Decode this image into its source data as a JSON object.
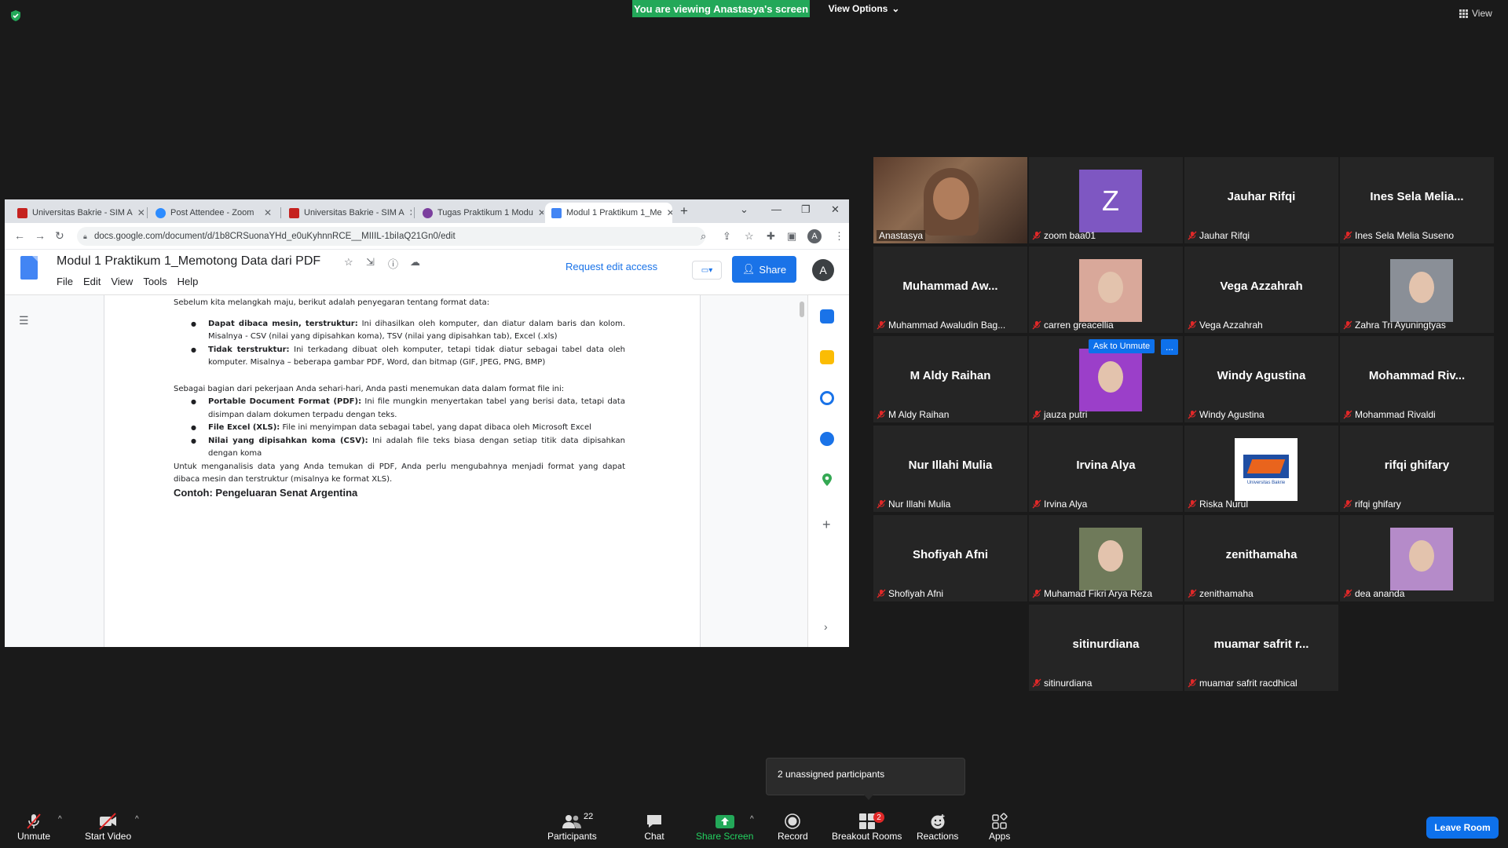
{
  "zoom": {
    "banner": "You are viewing Anastasya's screen",
    "view_options": "View Options",
    "view_label": "View"
  },
  "browser": {
    "tabs": [
      {
        "label": "Universitas Bakrie - SIM A",
        "fav_color": "#c5221f"
      },
      {
        "label": "Post Attendee - Zoom",
        "fav_color": "#2d8cff"
      },
      {
        "label": "Universitas Bakrie - SIM A",
        "fav_color": "#c5221f"
      },
      {
        "label": "Tugas Praktikum 1 Modu",
        "fav_color": "#7b3f9e"
      },
      {
        "label": "Modul 1 Praktikum 1_Me",
        "fav_color": "#4285f4",
        "active": true
      }
    ],
    "url": "docs.google.com/document/d/1b8CRSuonaYHd_e0uKyhnnRCE__MIIIL-1biIaQ21Gn0/edit",
    "profile_initial": "A"
  },
  "docs": {
    "title": "Modul 1 Praktikum 1_Memotong Data dari PDF",
    "menus": [
      "File",
      "Edit",
      "View",
      "Tools",
      "Help"
    ],
    "request_edit": "Request edit access",
    "share": "Share",
    "account_initial": "A",
    "intro": "Sebelum kita melangkah maju, berikut adalah penyegaran tentang format data:",
    "list1": [
      {
        "bold": "Dapat dibaca mesin, terstruktur:",
        "text": " Ini dihasilkan oleh komputer, dan diatur dalam baris dan kolom. Misalnya - CSV (nilai yang dipisahkan koma), TSV (nilai yang dipisahkan tab), Excel (.xls)"
      },
      {
        "bold": "Tidak terstruktur:",
        "text": " Ini terkadang dibuat oleh komputer, tetapi tidak diatur sebagai tabel data oleh komputer. Misalnya – beberapa gambar PDF, Word, dan bitmap (GIF, JPEG, PNG, BMP)"
      }
    ],
    "para2": "Sebagai bagian dari pekerjaan Anda sehari-hari, Anda pasti menemukan data dalam format file ini:",
    "list2": [
      {
        "bold": "Portable Document Format (PDF):",
        "text": " Ini file mungkin menyertakan tabel yang berisi data, tetapi data disimpan dalam dokumen terpadu dengan teks."
      },
      {
        "bold": "File Excel (XLS):",
        "text": " File ini menyimpan data sebagai tabel, yang dapat dibaca oleh Microsoft Excel"
      },
      {
        "bold": "Nilai yang dipisahkan koma (CSV):",
        "text": " Ini adalah file teks biasa dengan setiap titik data dipisahkan dengan koma"
      }
    ],
    "para3": "Untuk menganalisis data yang Anda temukan di PDF, Anda perlu mengubahnya menjadi format yang dapat dibaca mesin dan terstruktur (misalnya ke format XLS).",
    "heading": "Contoh: Pengeluaran Senat Argentina"
  },
  "participants": [
    {
      "center": "",
      "name": "Anastasya",
      "type": "video",
      "speaker": true
    },
    {
      "center": "",
      "name": "zoom baa01",
      "type": "letter",
      "letter": "Z",
      "color": "#7e57c2"
    },
    {
      "center": "Jauhar Rifqi",
      "name": "Jauhar Rifqi",
      "type": "name"
    },
    {
      "center": "Ines Sela Melia...",
      "name": "Ines Sela Melia Suseno",
      "type": "name"
    },
    {
      "center": "Muhammad Aw...",
      "name": "Muhammad Awaludin Bag...",
      "type": "name"
    },
    {
      "center": "",
      "name": "carren greacellia",
      "type": "photo",
      "color": "#d9a89a"
    },
    {
      "center": "Vega Azzahrah",
      "name": "Vega Azzahrah",
      "type": "name"
    },
    {
      "center": "",
      "name": "Zahra Tri Ayuningtyas",
      "type": "photo",
      "color": "#8a8f97"
    },
    {
      "center": "M Aldy Raihan",
      "name": "M Aldy Raihan",
      "type": "name"
    },
    {
      "center": "",
      "name": "jauza putri",
      "type": "photo",
      "color": "#9b3fc9"
    },
    {
      "center": "Windy Agustina",
      "name": "Windy Agustina",
      "type": "name"
    },
    {
      "center": "Mohammad Riv...",
      "name": "Mohammad Rivaldi",
      "type": "name"
    },
    {
      "center": "Nur Illahi Mulia",
      "name": "Nur Illahi Mulia",
      "type": "name"
    },
    {
      "center": "Irvina Alya",
      "name": "Irvina Alya",
      "type": "name"
    },
    {
      "center": "",
      "name": "Riska Nurul",
      "type": "logo"
    },
    {
      "center": "rifqi ghifary",
      "name": "rifqi ghifary",
      "type": "name"
    },
    {
      "center": "Shofiyah Afni",
      "name": "Shofiyah Afni",
      "type": "name"
    },
    {
      "center": "",
      "name": "Muhamad Fikri Arya Reza",
      "type": "photo",
      "color": "#6f7a5a"
    },
    {
      "center": "zenithamaha",
      "name": "zenithamaha",
      "type": "name"
    },
    {
      "center": "",
      "name": "dea ananda",
      "type": "photo",
      "color": "#b58bc9"
    },
    {
      "center": "sitinurdiana",
      "name": "sitinurdiana",
      "type": "name"
    },
    {
      "center": "muamar safrit r...",
      "name": "muamar safrit racdhical",
      "type": "name"
    }
  ],
  "ask_to_unmute": "Ask to Unmute",
  "ask_more": "...",
  "logo_text": "Universitas Bakrie",
  "toast": "2 unassigned participants",
  "toolbar": {
    "unmute": "Unmute",
    "start_video": "Start Video",
    "participants": "Participants",
    "participants_count": "22",
    "chat": "Chat",
    "share_screen": "Share Screen",
    "record": "Record",
    "breakout_rooms": "Breakout Rooms",
    "breakout_badge": "2",
    "reactions": "Reactions",
    "apps": "Apps",
    "leave": "Leave Room"
  },
  "colors": {
    "share_green": "#23a859",
    "speaker_border": "#c8e35a",
    "leave_blue": "#0e71eb",
    "docs_blue": "#1a73e8"
  }
}
